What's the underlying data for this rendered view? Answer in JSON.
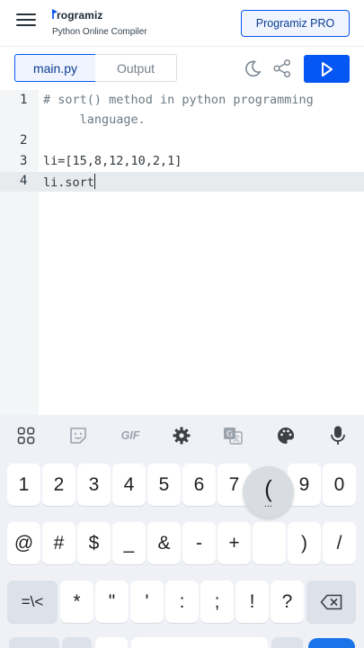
{
  "header": {
    "logo_text": "rogramiz",
    "subtitle": "Python Online Compiler",
    "pro_button": "Programiz PRO"
  },
  "toolbar": {
    "tab_main": "main.py",
    "tab_output": "Output",
    "icons": [
      "moon-icon",
      "share-icon",
      "run-play-icon"
    ]
  },
  "editor": {
    "lines": [
      {
        "no": "1",
        "text": "# sort() method in python programming"
      },
      {
        "no": "",
        "text": "     language."
      },
      {
        "no": "2",
        "text": ""
      },
      {
        "no": "3",
        "text": "li=[15,8,12,10,2,1]"
      },
      {
        "no": "4",
        "text": "li.sort"
      }
    ],
    "active_line": "4"
  },
  "keyboard": {
    "tools": [
      "apps-grid-icon",
      "sticker-icon",
      "GIF",
      "settings-icon",
      "translate-icon",
      "palette-icon",
      "microphone-icon"
    ],
    "gif_label": "GIF",
    "row1": [
      "1",
      "2",
      "3",
      "4",
      "5",
      "6",
      "7",
      "9",
      "0"
    ],
    "popup": "(",
    "popup_dots": "...",
    "row2": [
      "@",
      "#",
      "$",
      "_",
      "&",
      "-",
      "+",
      ")",
      "/"
    ],
    "row3": [
      "=\\<",
      "*",
      "\"",
      "'",
      ":",
      ";",
      "!",
      "?"
    ],
    "accent_color": "#1a73e8"
  },
  "colors": {
    "brand_blue": "#0556f3",
    "tab_bg": "#eff4ff"
  }
}
